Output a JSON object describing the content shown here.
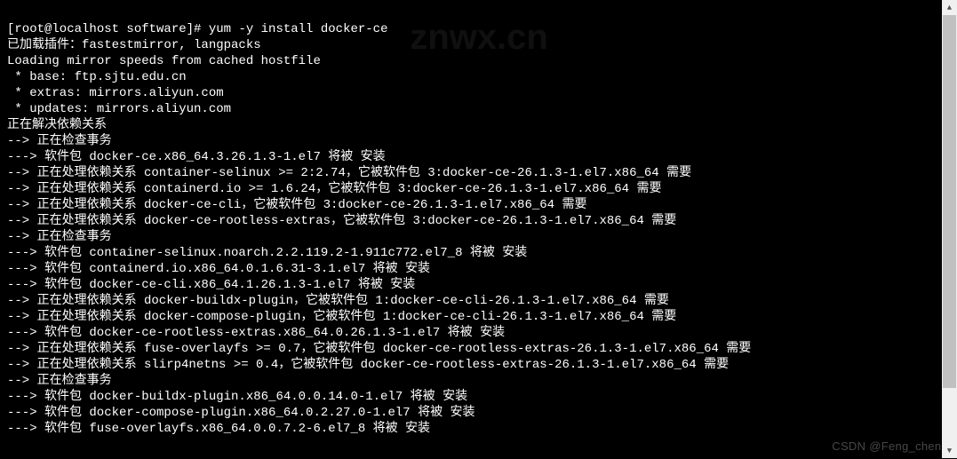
{
  "prompt": {
    "user_host": "[root@localhost software]# ",
    "command": "yum -y install docker-ce"
  },
  "lines": [
    "已加载插件：fastestmirror, langpacks",
    "Loading mirror speeds from cached hostfile",
    " * base: ftp.sjtu.edu.cn",
    " * extras: mirrors.aliyun.com",
    " * updates: mirrors.aliyun.com",
    "正在解决依赖关系",
    "--> 正在检查事务",
    "---> 软件包 docker-ce.x86_64.3.26.1.3-1.el7 将被 安装",
    "--> 正在处理依赖关系 container-selinux >= 2:2.74，它被软件包 3:docker-ce-26.1.3-1.el7.x86_64 需要",
    "--> 正在处理依赖关系 containerd.io >= 1.6.24，它被软件包 3:docker-ce-26.1.3-1.el7.x86_64 需要",
    "--> 正在处理依赖关系 docker-ce-cli，它被软件包 3:docker-ce-26.1.3-1.el7.x86_64 需要",
    "--> 正在处理依赖关系 docker-ce-rootless-extras，它被软件包 3:docker-ce-26.1.3-1.el7.x86_64 需要",
    "--> 正在检查事务",
    "---> 软件包 container-selinux.noarch.2.2.119.2-1.911c772.el7_8 将被 安装",
    "---> 软件包 containerd.io.x86_64.0.1.6.31-3.1.el7 将被 安装",
    "---> 软件包 docker-ce-cli.x86_64.1.26.1.3-1.el7 将被 安装",
    "--> 正在处理依赖关系 docker-buildx-plugin，它被软件包 1:docker-ce-cli-26.1.3-1.el7.x86_64 需要",
    "--> 正在处理依赖关系 docker-compose-plugin，它被软件包 1:docker-ce-cli-26.1.3-1.el7.x86_64 需要",
    "---> 软件包 docker-ce-rootless-extras.x86_64.0.26.1.3-1.el7 将被 安装",
    "--> 正在处理依赖关系 fuse-overlayfs >= 0.7，它被软件包 docker-ce-rootless-extras-26.1.3-1.el7.x86_64 需要",
    "--> 正在处理依赖关系 slirp4netns >= 0.4，它被软件包 docker-ce-rootless-extras-26.1.3-1.el7.x86_64 需要",
    "--> 正在检查事务",
    "---> 软件包 docker-buildx-plugin.x86_64.0.0.14.0-1.el7 将被 安装",
    "---> 软件包 docker-compose-plugin.x86_64.0.2.27.0-1.el7 将被 安装",
    "---> 软件包 fuse-overlayfs.x86_64.0.0.7.2-6.el7_8 将被 安装"
  ],
  "watermark": {
    "top": "znwx.cn",
    "bottom": "CSDN @Feng_cheng"
  },
  "scrollbar": {
    "up": "▲",
    "down": "▼"
  }
}
